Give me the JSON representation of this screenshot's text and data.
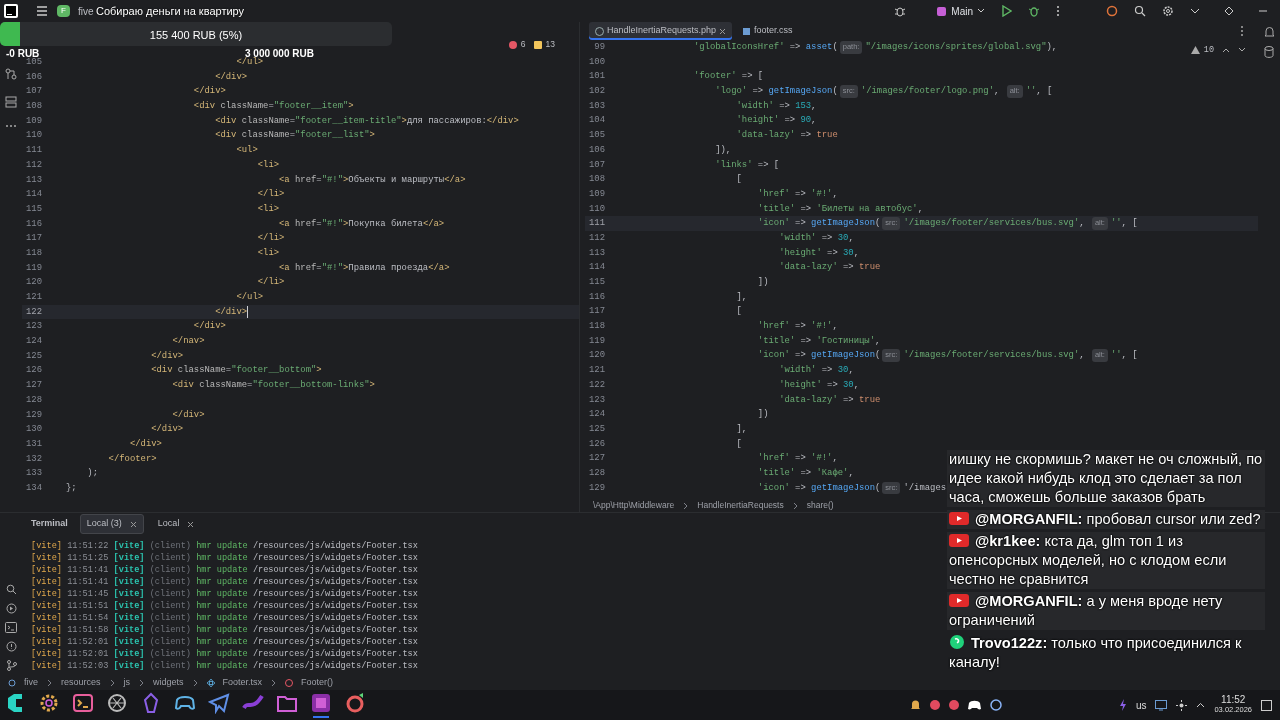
{
  "topbar": {
    "project_badge": "F",
    "project": "five",
    "run_config": "Main"
  },
  "donation": {
    "title": "Собираю деньги на квартиру",
    "amount": "155 400 RUB (5%)",
    "level": 0.05,
    "min": "-0 RUB",
    "max": "3 000 000 RUB"
  },
  "left_editor": {
    "errors": "6",
    "warnings": "13",
    "lines": [
      {
        "n": "105",
        "code": "                                </ul>",
        "current": false
      },
      {
        "n": "106",
        "code": "                            </div>",
        "current": false
      },
      {
        "n": "107",
        "code": "                        </div>",
        "current": false
      },
      {
        "n": "108",
        "code": "                        <div className=\"footer__item\">",
        "current": false
      },
      {
        "n": "109",
        "code": "                            <div className=\"footer__item-title\">для пассажиров:</div>",
        "current": false
      },
      {
        "n": "110",
        "code": "                            <div className=\"footer__list\">",
        "current": false
      },
      {
        "n": "111",
        "code": "                                <ul>",
        "current": false
      },
      {
        "n": "112",
        "code": "                                    <li>",
        "current": false
      },
      {
        "n": "113",
        "code": "                                        <a href=\"#!\">Объекты и маршруты</a>",
        "current": false
      },
      {
        "n": "114",
        "code": "                                    </li>",
        "current": false
      },
      {
        "n": "115",
        "code": "                                    <li>",
        "current": false
      },
      {
        "n": "116",
        "code": "                                        <a href=\"#!\">Покупка билета</a>",
        "current": false
      },
      {
        "n": "117",
        "code": "                                    </li>",
        "current": false
      },
      {
        "n": "118",
        "code": "                                    <li>",
        "current": false
      },
      {
        "n": "119",
        "code": "                                        <a href=\"#!\">Правила проезда</a>",
        "current": false
      },
      {
        "n": "120",
        "code": "                                    </li>",
        "current": false
      },
      {
        "n": "121",
        "code": "                                </ul>",
        "current": false
      },
      {
        "n": "122",
        "code": "                            </div>",
        "current": true
      },
      {
        "n": "123",
        "code": "                        </div>",
        "current": false
      },
      {
        "n": "124",
        "code": "                    </nav>",
        "current": false
      },
      {
        "n": "125",
        "code": "                </div>",
        "current": false
      },
      {
        "n": "126",
        "code": "                <div className=\"footer__bottom\">",
        "current": false
      },
      {
        "n": "127",
        "code": "                    <div className=\"footer__bottom-links\">",
        "current": false
      },
      {
        "n": "128",
        "current": false
      },
      {
        "n": "129",
        "code": "                    </div>",
        "current": false
      },
      {
        "n": "130",
        "code": "                </div>",
        "current": false
      },
      {
        "n": "131",
        "code": "            </div>",
        "current": false
      },
      {
        "n": "132",
        "code": "        </footer>",
        "current": false
      },
      {
        "n": "133",
        "code": "    );",
        "current": false
      },
      {
        "n": "134",
        "code": "};",
        "current": false
      }
    ]
  },
  "right_editor": {
    "tabs": [
      {
        "label": "HandleInertiaRequests.php",
        "selected": true
      },
      {
        "label": "footer.css",
        "selected": false
      }
    ],
    "warnings": "10",
    "lines": [
      {
        "n": "99",
        "current": false,
        "parts": [
          {
            "kind": "code",
            "text": "            'globalIconsHref' => asset("
          },
          {
            "kind": "hint",
            "text": "path:"
          },
          {
            "kind": "code",
            "text": "\"/images/icons/sprites/global.svg\"),"
          }
        ]
      },
      {
        "n": "100",
        "current": false
      },
      {
        "n": "101",
        "current": false,
        "code": "            'footer' => ["
      },
      {
        "n": "102",
        "current": false,
        "parts": [
          {
            "kind": "code",
            "text": "                'logo' => getImageJson("
          },
          {
            "kind": "hint",
            "text": "src:"
          },
          {
            "kind": "code",
            "text": "'/images/footer/logo.png', "
          },
          {
            "kind": "hint",
            "text": "alt:"
          },
          {
            "kind": "code",
            "text": "'', ["
          }
        ]
      },
      {
        "n": "103",
        "current": false,
        "code": "                    'width' => 153,"
      },
      {
        "n": "104",
        "current": false,
        "code": "                    'height' => 90,"
      },
      {
        "n": "105",
        "current": false,
        "code": "                    'data-lazy' => true"
      },
      {
        "n": "106",
        "current": false,
        "code": "                ]),"
      },
      {
        "n": "107",
        "current": false,
        "code": "                'links' => ["
      },
      {
        "n": "108",
        "current": false,
        "code": "                    ["
      },
      {
        "n": "109",
        "current": false,
        "code": "                        'href' => '#!',"
      },
      {
        "n": "110",
        "current": false,
        "code": "                        'title' => 'Билеты на автобус',"
      },
      {
        "n": "111",
        "current": true,
        "parts": [
          {
            "kind": "code",
            "text": "                        'icon' => getImageJson("
          },
          {
            "kind": "hint",
            "text": "src:"
          },
          {
            "kind": "code",
            "text": "'/images/footer/services/bus.svg', "
          },
          {
            "kind": "hint",
            "text": "alt:"
          },
          {
            "kind": "code",
            "text": "'', ["
          }
        ]
      },
      {
        "n": "112",
        "current": false,
        "code": "                            'width' => 30,"
      },
      {
        "n": "113",
        "current": false,
        "code": "                            'height' => 30,"
      },
      {
        "n": "114",
        "current": false,
        "code": "                            'data-lazy' => true"
      },
      {
        "n": "115",
        "current": false,
        "code": "                        ])"
      },
      {
        "n": "116",
        "current": false,
        "code": "                    ],"
      },
      {
        "n": "117",
        "current": false,
        "code": "                    ["
      },
      {
        "n": "118",
        "current": false,
        "code": "                        'href' => '#!',"
      },
      {
        "n": "119",
        "current": false,
        "code": "                        'title' => 'Гостиницы',"
      },
      {
        "n": "120",
        "current": false,
        "parts": [
          {
            "kind": "code",
            "text": "                        'icon' => getImageJson("
          },
          {
            "kind": "hint",
            "text": "src:"
          },
          {
            "kind": "code",
            "text": "'/images/footer/services/bus.svg', "
          },
          {
            "kind": "hint",
            "text": "alt:"
          },
          {
            "kind": "code",
            "text": "'', ["
          }
        ]
      },
      {
        "n": "121",
        "current": false,
        "code": "                            'width' => 30,"
      },
      {
        "n": "122",
        "current": false,
        "code": "                            'height' => 30,"
      },
      {
        "n": "123",
        "current": false,
        "code": "                            'data-lazy' => true"
      },
      {
        "n": "124",
        "current": false,
        "code": "                        ])"
      },
      {
        "n": "125",
        "current": false,
        "code": "                    ],"
      },
      {
        "n": "126",
        "current": false,
        "code": "                    ["
      },
      {
        "n": "127",
        "current": false,
        "code": "                        'href' => '#!',"
      },
      {
        "n": "128",
        "current": false,
        "code": "                        'title' => 'Кафе',"
      },
      {
        "n": "129",
        "current": false,
        "parts": [
          {
            "kind": "code",
            "text": "                        'icon' => getImageJson("
          },
          {
            "kind": "hint",
            "text": "src:"
          },
          {
            "kind": "code",
            "text": "'/images"
          }
        ]
      }
    ],
    "breadcrumb": [
      "\\App\\Http\\Middleware",
      "HandleInertiaRequests",
      "share()"
    ]
  },
  "terminal": {
    "title": "Terminal",
    "tabs": [
      {
        "label": "Local (3)",
        "selected": true
      },
      {
        "label": "Local",
        "selected": false
      }
    ],
    "lines": [
      {
        "prefix": "[vite]",
        "time": "11:51:22",
        "tag": "[vite]",
        "source": "(client)",
        "action": "hmr update",
        "path": "/resources/js/widgets/Footer.tsx"
      },
      {
        "prefix": "[vite]",
        "time": "11:51:25",
        "tag": "[vite]",
        "source": "(client)",
        "action": "hmr update",
        "path": "/resources/js/widgets/Footer.tsx"
      },
      {
        "prefix": "[vite]",
        "time": "11:51:41",
        "tag": "[vite]",
        "source": "(client)",
        "action": "hmr update",
        "path": "/resources/js/widgets/Footer.tsx"
      },
      {
        "prefix": "[vite]",
        "time": "11:51:41",
        "tag": "[vite]",
        "source": "(client)",
        "action": "hmr update",
        "path": "/resources/js/widgets/Footer.tsx"
      },
      {
        "prefix": "[vite]",
        "time": "11:51:45",
        "tag": "[vite]",
        "source": "(client)",
        "action": "hmr update",
        "path": "/resources/js/widgets/Footer.tsx"
      },
      {
        "prefix": "[vite]",
        "time": "11:51:51",
        "tag": "[vite]",
        "source": "(client)",
        "action": "hmr update",
        "path": "/resources/js/widgets/Footer.tsx"
      },
      {
        "prefix": "[vite]",
        "time": "11:51:54",
        "tag": "[vite]",
        "source": "(client)",
        "action": "hmr update",
        "path": "/resources/js/widgets/Footer.tsx"
      },
      {
        "prefix": "[vite]",
        "time": "11:51:58",
        "tag": "[vite]",
        "source": "(client)",
        "action": "hmr update",
        "path": "/resources/js/widgets/Footer.tsx"
      },
      {
        "prefix": "[vite]",
        "time": "11:52:01",
        "tag": "[vite]",
        "source": "(client)",
        "action": "hmr update",
        "path": "/resources/js/widgets/Footer.tsx"
      },
      {
        "prefix": "[vite]",
        "time": "11:52:01",
        "tag": "[vite]",
        "source": "(client)",
        "action": "hmr update",
        "path": "/resources/js/widgets/Footer.tsx"
      },
      {
        "prefix": "[vite]",
        "time": "11:52:03",
        "tag": "[vite]",
        "source": "(client)",
        "action": "hmr update",
        "path": "/resources/js/widgets/Footer.tsx"
      }
    ]
  },
  "breadcrumb": [
    {
      "kind": "project",
      "text": "five"
    },
    {
      "kind": "folder",
      "text": "resources"
    },
    {
      "kind": "folder",
      "text": "js"
    },
    {
      "kind": "folder",
      "text": "widgets"
    },
    {
      "kind": "file",
      "text": "Footer.tsx"
    },
    {
      "kind": "function",
      "text": "Footer()"
    }
  ],
  "chat": [
    {
      "text": "иишку не скормишь? макет не оч сложный, по идее какой нибудь клод это сделает за пол часа, сможешь больше заказов брать"
    },
    {
      "kind": "youtube",
      "author": "@MORGANFIL:",
      "text": "пробовал cursor или zed?"
    },
    {
      "kind": "youtube",
      "author": "@kr1kee:",
      "text": "кста да, glm топ 1 из опенсорсных моделей, но с клодом если честно не сравнится"
    },
    {
      "kind": "youtube",
      "author": "@MORGANFIL:",
      "text": "а у меня вроде нету ограничений"
    },
    {
      "kind": "trovo",
      "author": "Trovo122z:",
      "text": "только что присоединился к каналу!"
    }
  ],
  "taskbar": {
    "apps": [
      {
        "kind": "launcher",
        "selected": false
      },
      {
        "kind": "gear",
        "selected": false
      },
      {
        "kind": "terminal",
        "selected": false
      },
      {
        "kind": "aperture",
        "selected": false
      },
      {
        "kind": "gem",
        "selected": false
      },
      {
        "kind": "gamepad",
        "selected": false
      },
      {
        "kind": "plane",
        "selected": false
      },
      {
        "kind": "wave",
        "selected": false
      },
      {
        "kind": "folder",
        "selected": false
      },
      {
        "kind": "ide",
        "selected": true
      },
      {
        "kind": "ring",
        "selected": false
      }
    ],
    "layout": "us",
    "time": "11:52",
    "date": "03.02.2026"
  }
}
